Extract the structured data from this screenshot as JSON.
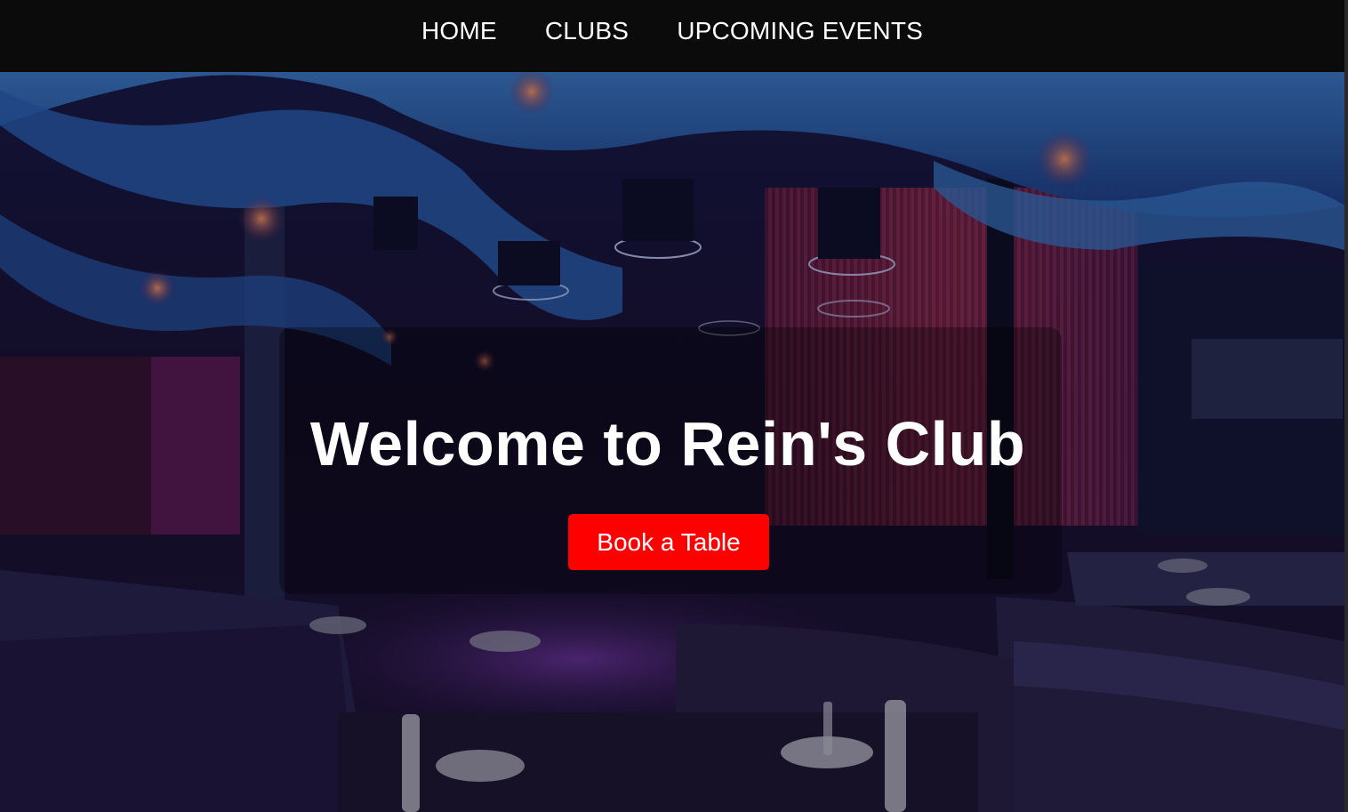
{
  "nav": {
    "items": [
      {
        "label": "HOME"
      },
      {
        "label": "CLUBS"
      },
      {
        "label": "UPCOMING EVENTS"
      }
    ]
  },
  "hero": {
    "title": "Welcome to Rein's Club",
    "cta_label": "Book a Table",
    "background_image": "nightclub-interior"
  },
  "colors": {
    "nav_bg": "#0b0b0b",
    "cta_bg": "#ff0000",
    "text": "#ffffff"
  }
}
